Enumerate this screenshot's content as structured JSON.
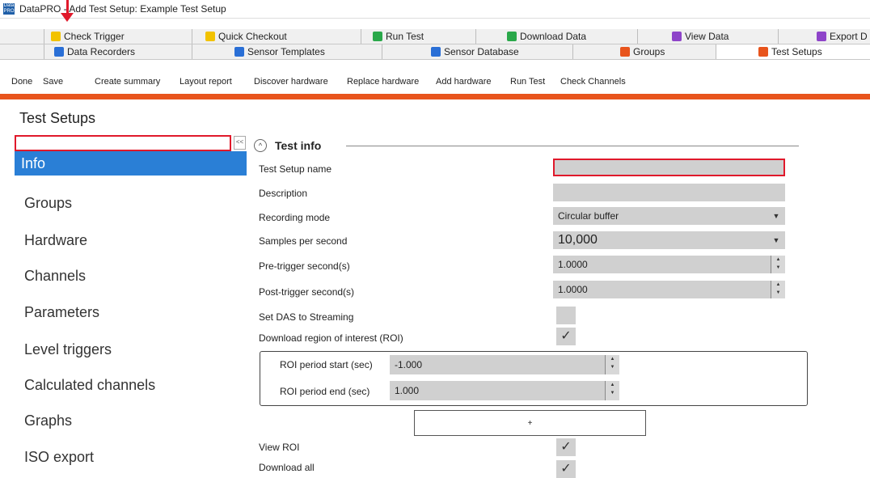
{
  "window": {
    "title": "DataPRO - Add Test Setup: Example Test Setup",
    "app_icon_text": "Data PRO"
  },
  "tabs_row1": [
    {
      "label": "Check Trigger",
      "icon_color": "#f2c200",
      "icon": "trigger-icon"
    },
    {
      "label": "Quick Checkout",
      "icon_color": "#f2c200",
      "icon": "checkout-icon"
    },
    {
      "label": "Run Test",
      "icon_color": "#2aa84a",
      "icon": "run-icon"
    },
    {
      "label": "Download Data",
      "icon_color": "#2aa84a",
      "icon": "download-icon"
    },
    {
      "label": "View Data",
      "icon_color": "#8e44c9",
      "icon": "view-icon"
    },
    {
      "label": "Export D",
      "icon_color": "#8e44c9",
      "icon": "export-icon"
    }
  ],
  "tabs_row2": [
    {
      "label": "Data Recorders",
      "icon_color": "#2a6fd6",
      "icon": "recorder-icon"
    },
    {
      "label": "Sensor Templates",
      "icon_color": "#2a6fd6",
      "icon": "template-icon"
    },
    {
      "label": "Sensor Database",
      "icon_color": "#2a6fd6",
      "icon": "database-icon"
    },
    {
      "label": "Groups",
      "icon_color": "#e8541c",
      "icon": "groups-icon"
    },
    {
      "label": "Test Setups",
      "icon_color": "#e8541c",
      "icon": "test-setups-icon"
    }
  ],
  "toolbar": [
    "Done",
    "Save",
    "Create summary",
    "Layout report",
    "Discover hardware",
    "Replace hardware",
    "Add hardware",
    "Run Test",
    "Check Channels"
  ],
  "colors": {
    "accent": "#e8541c",
    "selection": "#2a7fd6",
    "highlight": "#e0192b"
  },
  "left": {
    "section_title": "Test Setups",
    "collapse_label": "<<",
    "nav": [
      "Info",
      "Groups",
      "Hardware",
      "Channels",
      "Parameters",
      "Level triggers",
      "Calculated channels",
      "Graphs",
      "ISO export"
    ]
  },
  "test_info": {
    "header": "Test info",
    "collapse_glyph": "^",
    "labels": {
      "name": "Test Setup name",
      "description": "Description",
      "recording_mode": "Recording mode",
      "samples": "Samples per second",
      "pre": "Pre-trigger second(s)",
      "post": "Post-trigger second(s)",
      "das": "Set DAS to Streaming",
      "roi": "Download region of interest (ROI)",
      "view_roi": "View ROI",
      "download_all": "Download all"
    },
    "values": {
      "name": "",
      "description": "",
      "recording_mode": "Circular buffer",
      "samples": "10,000",
      "pre": "1.0000",
      "post": "1.0000",
      "das": false,
      "roi": true,
      "view_roi": true,
      "check_glyph": "✓"
    },
    "roi_rows": [
      {
        "label": "ROI period start (sec)",
        "value": "-1.000"
      },
      {
        "label": "ROI period end (sec)",
        "value": "1.000"
      }
    ],
    "add_roi_label": "+"
  }
}
